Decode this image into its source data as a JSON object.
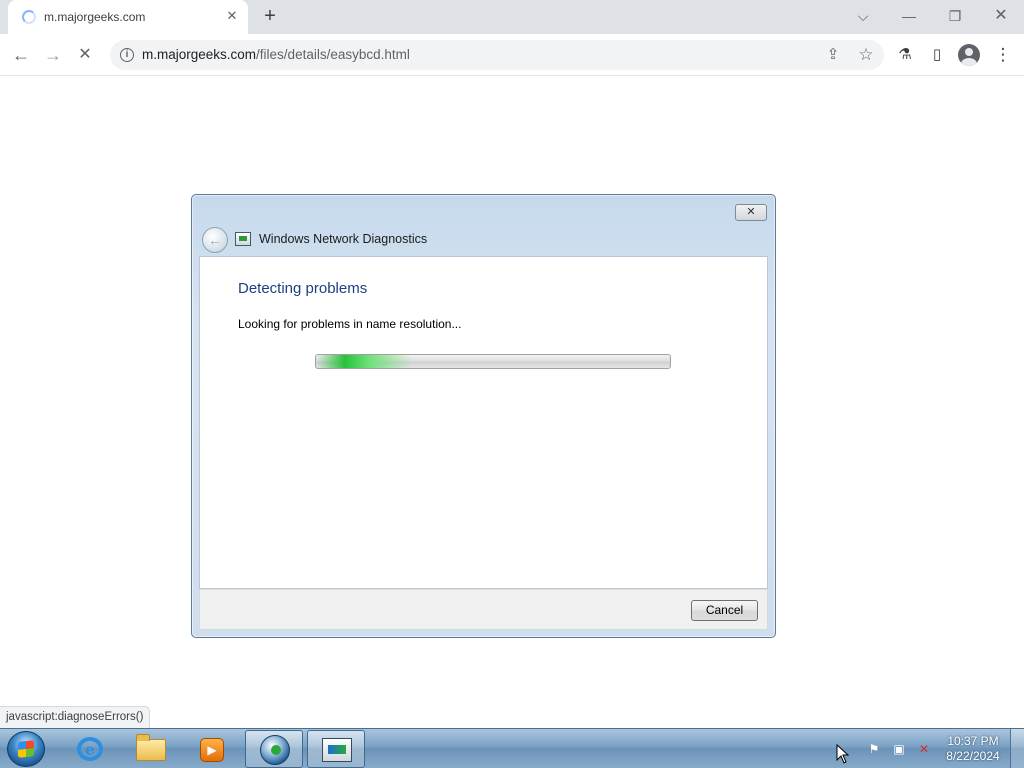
{
  "browser": {
    "tab_title": "m.majorgeeks.com",
    "tab_close_glyph": "✕",
    "new_tab_glyph": "+",
    "url_host": "m.majorgeeks.com",
    "url_path": "/files/details/easybcd.html",
    "window_controls": {
      "tab_search": "⌵",
      "minimize": "—",
      "restore": "❐",
      "close": "✕"
    },
    "nav": {
      "back": "←",
      "forward": "→",
      "stop": "✕"
    },
    "omnibox_icons": {
      "share": "⇪",
      "bookmark": "☆"
    },
    "toolbar_icons": {
      "labs": "⚗",
      "side_panel": "▯",
      "menu": "⋮"
    }
  },
  "dialog": {
    "title": "Windows Network Diagnostics",
    "close_glyph": "✕",
    "back_glyph": "←",
    "heading": "Detecting problems",
    "status": "Looking for problems in name resolution...",
    "progress_fraction": 0.27,
    "cancel_label": "Cancel"
  },
  "status_bar": {
    "link": "javascript:diagnoseErrors()"
  },
  "taskbar": {
    "ie_glyph": "e",
    "media_glyph": "▶",
    "tray": {
      "flag": "⚑",
      "network": "▣",
      "volume": "✕"
    },
    "clock_time": "10:37 PM",
    "clock_date": "8/22/2024"
  },
  "colors": {
    "dialog_heading": "#1e3f83",
    "progress_green": "#27c33a",
    "taskbar": "#7aa1c4"
  }
}
